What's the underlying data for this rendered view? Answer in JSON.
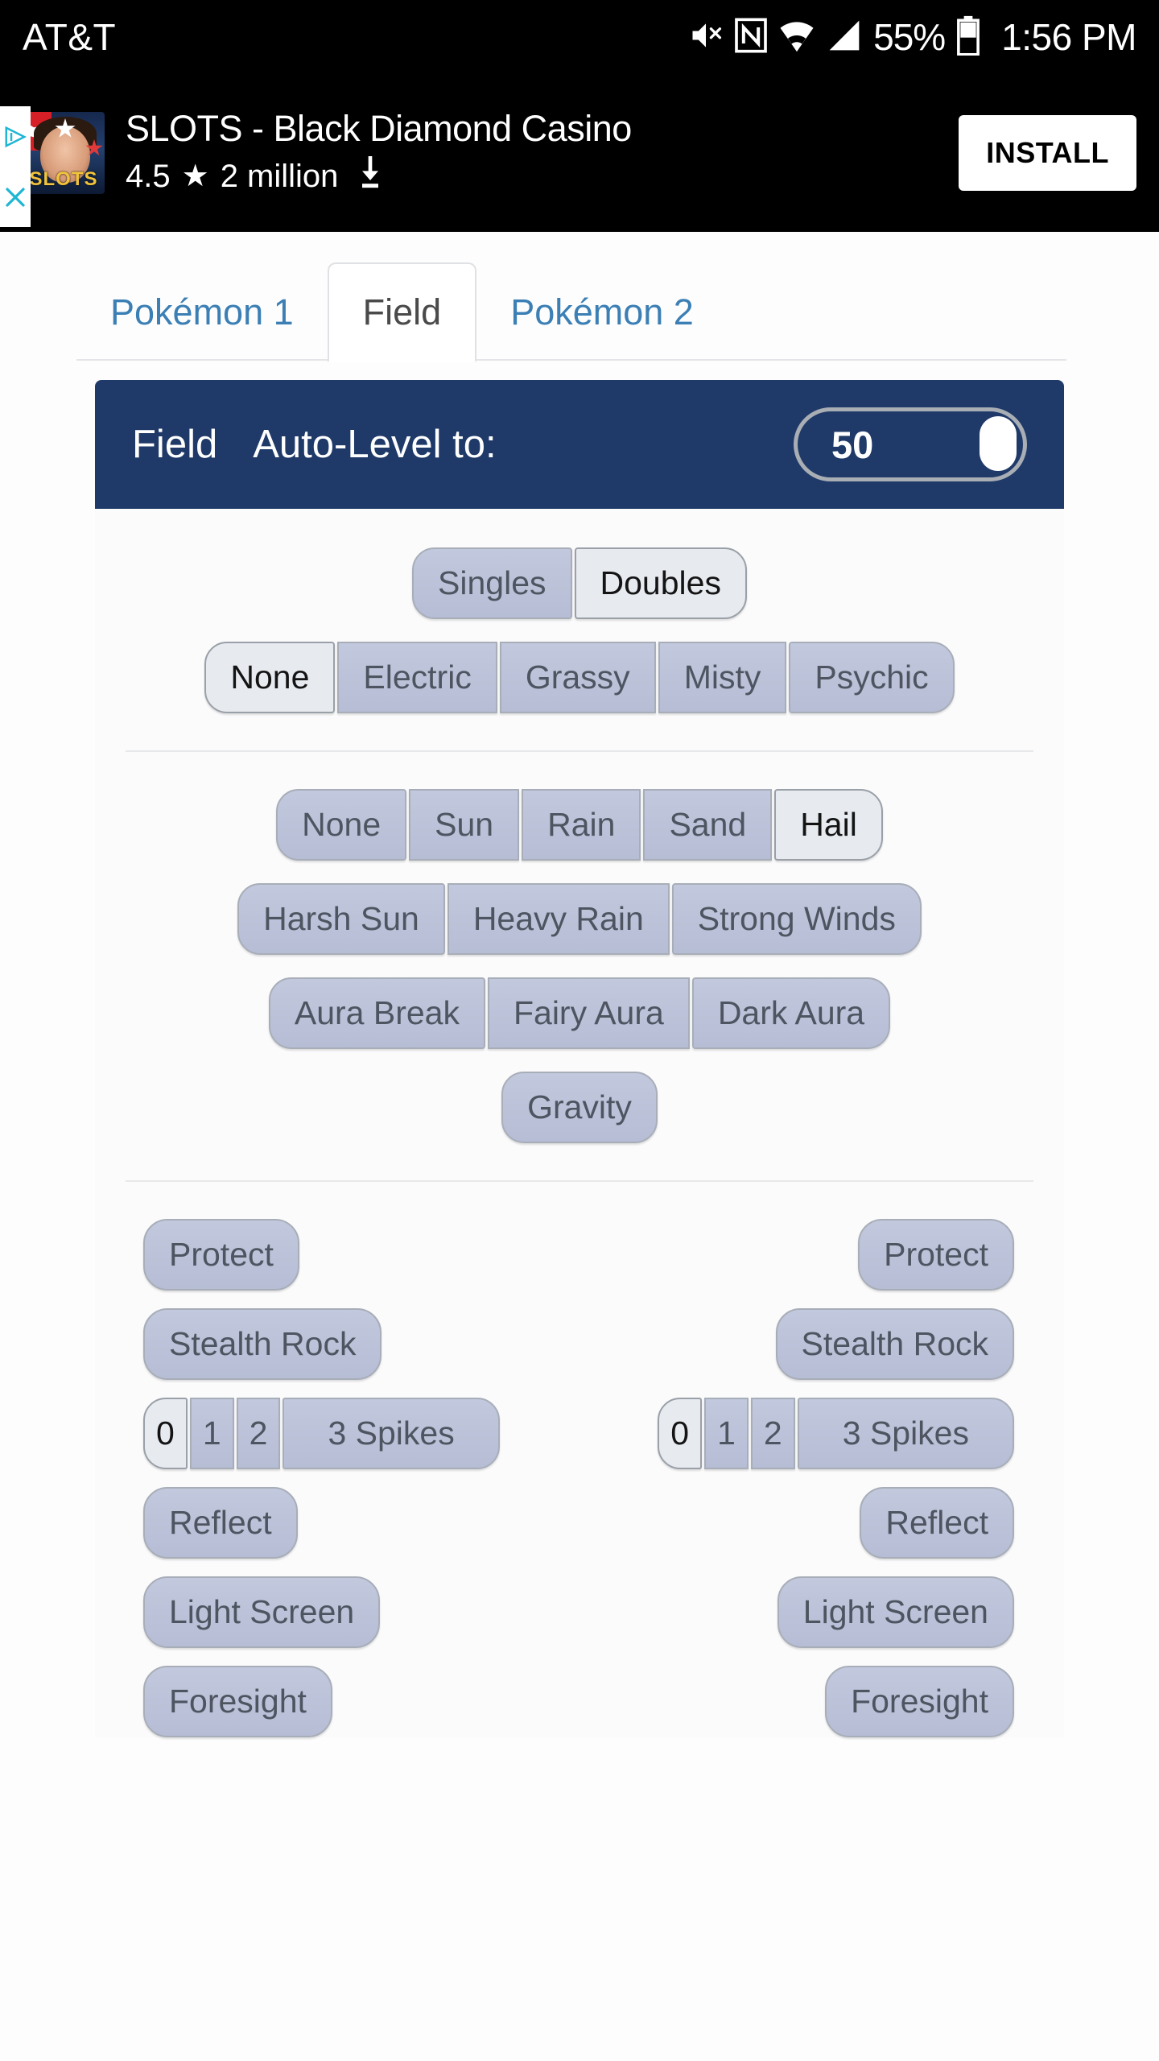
{
  "status_bar": {
    "carrier": "AT&T",
    "battery_percent": "55%",
    "clock": "1:56 PM",
    "icons": [
      "mute-icon",
      "nfc-icon",
      "wifi-icon",
      "cellular-signal-icon",
      "battery-icon"
    ]
  },
  "ad": {
    "app_name": "SLOTS - Black Diamond Casino",
    "rating": "4.5",
    "star_glyph": "★",
    "downloads": "2 million",
    "download_glyph": "⬇",
    "install_label": "INSTALL",
    "thumb_label": "SLOTS"
  },
  "tabs": [
    {
      "label": "Pokémon 1",
      "active": false
    },
    {
      "label": "Field",
      "active": true
    },
    {
      "label": "Pokémon 2",
      "active": false
    }
  ],
  "field_card": {
    "title": "Field",
    "auto_level_label": "Auto-Level to:",
    "auto_level_value": "50",
    "header_color": "#1f3a68"
  },
  "format_group": {
    "options": [
      "Singles",
      "Doubles"
    ],
    "selected": "Doubles"
  },
  "terrain_group": {
    "options": [
      "None",
      "Electric",
      "Grassy",
      "Misty",
      "Psychic"
    ],
    "selected": "None"
  },
  "weather_group": {
    "options": [
      "None",
      "Sun",
      "Rain",
      "Sand",
      "Hail"
    ],
    "selected": "Hail"
  },
  "extreme_weather": {
    "options": [
      "Harsh Sun",
      "Heavy Rain",
      "Strong Winds"
    ],
    "selected": null
  },
  "aura": {
    "options": [
      "Aura Break",
      "Fairy Aura",
      "Dark Aura"
    ],
    "selected": null
  },
  "gravity": {
    "label": "Gravity",
    "selected": false
  },
  "hazards": {
    "left": {
      "protect": "Protect",
      "stealth_rock": "Stealth Rock",
      "spikes_counts": [
        "0",
        "1",
        "2"
      ],
      "spikes_selected": "0",
      "spikes_label": "3 Spikes",
      "reflect": "Reflect",
      "light_screen": "Light Screen",
      "foresight": "Foresight"
    },
    "right": {
      "protect": "Protect",
      "stealth_rock": "Stealth Rock",
      "spikes_counts": [
        "0",
        "1",
        "2"
      ],
      "spikes_selected": "0",
      "spikes_label": "3 Spikes",
      "reflect": "Reflect",
      "light_screen": "Light Screen",
      "foresight": "Foresight"
    }
  },
  "colors": {
    "accent_header": "#1f3a68",
    "tab_link": "#3b7fb5",
    "button_idle": "#bcc3da",
    "button_selected": "#e7eaef"
  }
}
